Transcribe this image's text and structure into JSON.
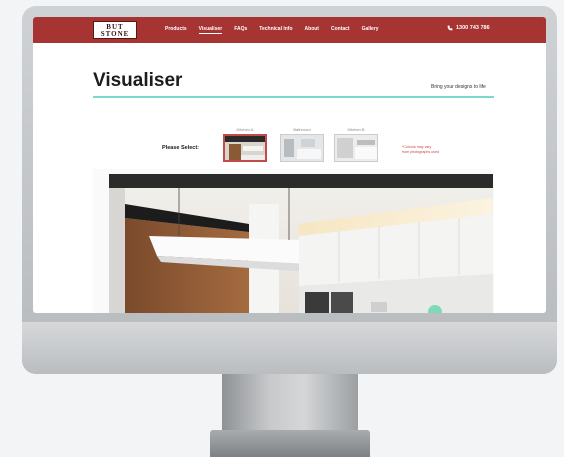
{
  "site": {
    "logo": {
      "line1": "BUT",
      "line2": "STONE"
    },
    "nav": {
      "items": [
        {
          "label": "Products"
        },
        {
          "label": "Visualiser"
        },
        {
          "label": "FAQs"
        },
        {
          "label": "Technical Info"
        },
        {
          "label": "About"
        },
        {
          "label": "Contact"
        },
        {
          "label": "Gallery"
        }
      ],
      "active": "Visualiser"
    },
    "phone": "1300 743 786"
  },
  "page": {
    "title": "Visualiser",
    "tagline": "Bring your designs to life"
  },
  "selector": {
    "prompt": "Please Select:",
    "options": [
      {
        "label": "Kitchen A",
        "selected": true
      },
      {
        "label": "Bathroom",
        "selected": false
      },
      {
        "label": "Kitchen B",
        "selected": false
      }
    ],
    "note_line1": "*Colours may vary",
    "note_line2": "from photographs used"
  },
  "colors": {
    "brand": "#a63433",
    "accent_rule": "#7dd9cf",
    "selected_border": "#c24a48"
  },
  "icons": [
    "phone-icon"
  ]
}
